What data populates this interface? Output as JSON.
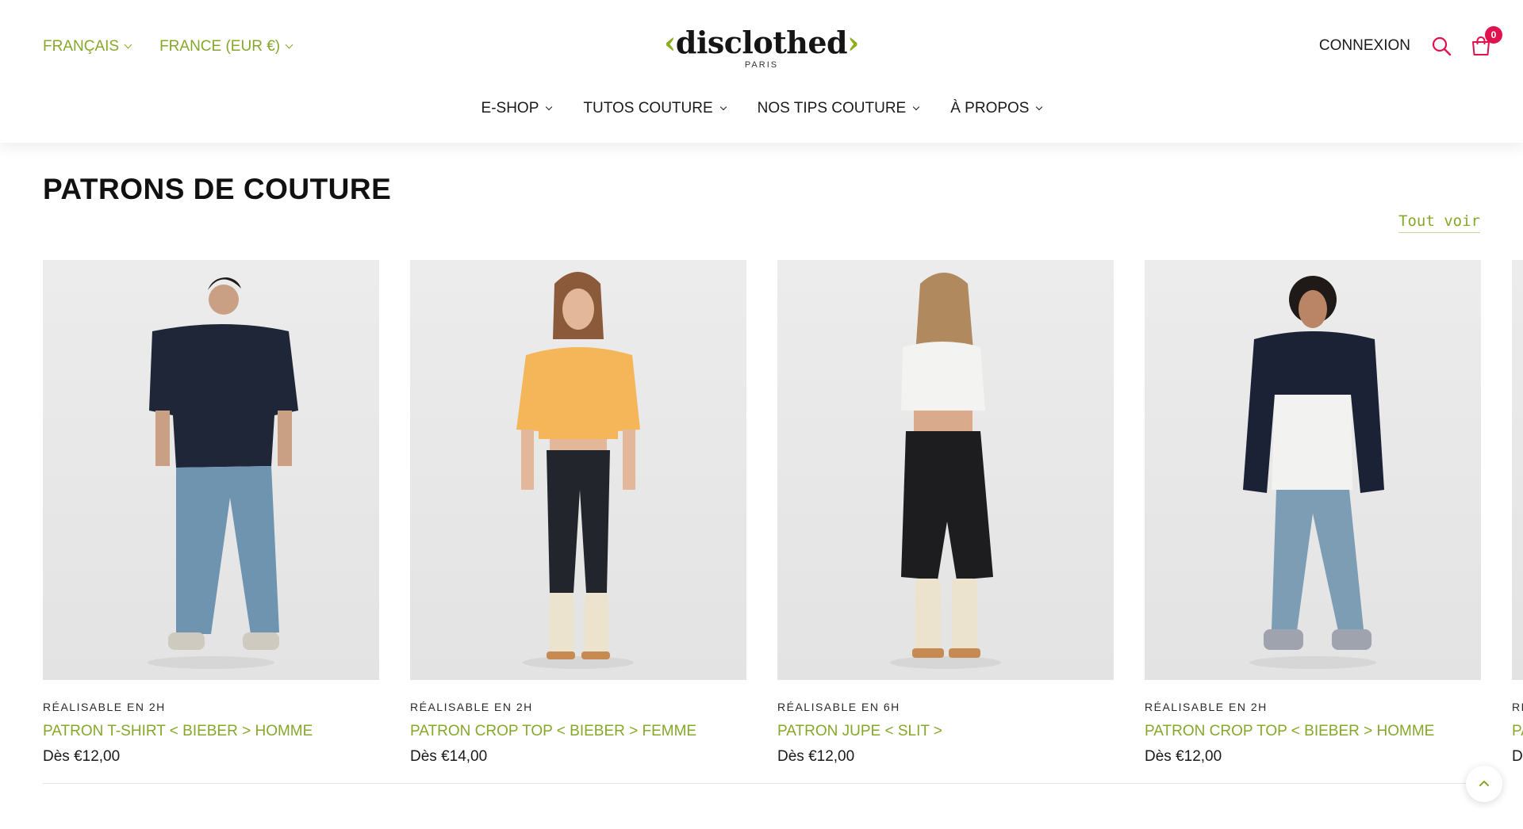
{
  "header": {
    "language": "FRANÇAIS",
    "country": "FRANCE (EUR €)",
    "brand": {
      "bracket_left": "‹",
      "name": "disclothed",
      "bracket_right": "›",
      "city": "PARIS"
    },
    "login": "CONNEXION",
    "cart_count": "0",
    "icons": {
      "search": "search-icon",
      "cart": "shopping-bag-icon"
    },
    "accent_color": "#86a82a",
    "badge_color": "#e0124d"
  },
  "nav": {
    "items": [
      {
        "label": "E-SHOP"
      },
      {
        "label": "TUTOS COUTURE"
      },
      {
        "label": "NOS TIPS COUTURE"
      },
      {
        "label": "À PROPOS"
      }
    ]
  },
  "section": {
    "title": "PATRONS DE COUTURE",
    "view_all": "Tout voir"
  },
  "products": [
    {
      "tag": "RÉALISABLE EN 2H",
      "title": "PATRON T-SHIRT < BIEBER > HOMME",
      "price": "Dès €12,00"
    },
    {
      "tag": "RÉALISABLE EN 2H",
      "title": "PATRON CROP TOP < BIEBER > FEMME",
      "price": "Dès €14,00"
    },
    {
      "tag": "RÉALISABLE EN 6H",
      "title": "PATRON JUPE < SLIT >",
      "price": "Dès €12,00"
    },
    {
      "tag": "RÉALISABLE EN 2H",
      "title": "PATRON CROP TOP < BIEBER > HOMME",
      "price": "Dès €12,00"
    },
    {
      "tag": "RÉ",
      "title": "PA",
      "price": "D"
    }
  ],
  "back_to_top": {
    "icon": "chevron-up-icon"
  }
}
